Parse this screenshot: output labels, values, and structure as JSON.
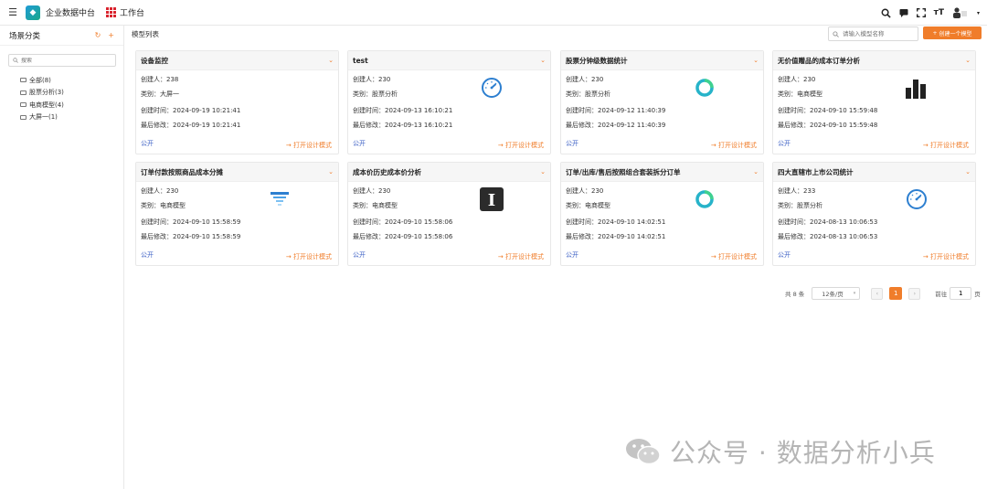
{
  "header": {
    "app_title": "企业数据中台",
    "workbench": "工作台"
  },
  "sidebar": {
    "title": "场景分类",
    "search_placeholder": "搜索",
    "items": [
      {
        "label": "全部(8)"
      },
      {
        "label": "股票分析(3)"
      },
      {
        "label": "电商模型(4)"
      },
      {
        "label": "大屏一(1)"
      }
    ]
  },
  "main": {
    "breadcrumb": "模型列表",
    "search_placeholder": "请输入模型名称",
    "create_label": "创建一个模型"
  },
  "cards": [
    {
      "title": "设备监控",
      "creator": "创建人：238",
      "category": "类别：大屏一",
      "created": "创建时间：2024-09-19 10:21:41",
      "modified": "最后修改：2024-09-19 10:21:41",
      "visibility": "公开",
      "open": "打开设计模式",
      "thumb": "none"
    },
    {
      "title": "test",
      "creator": "创建人：230",
      "category": "类别：股票分析",
      "created": "创建时间：2024-09-13 16:10:21",
      "modified": "最后修改：2024-09-13 16:10:21",
      "visibility": "公开",
      "open": "打开设计模式",
      "thumb": "gauge-icon"
    },
    {
      "title": "股票分钟级数据统计",
      "creator": "创建人：230",
      "category": "类别：股票分析",
      "created": "创建时间：2024-09-12 11:40:39",
      "modified": "最后修改：2024-09-12 11:40:39",
      "visibility": "公开",
      "open": "打开设计模式",
      "thumb": "ring-icon"
    },
    {
      "title": "无价值赠品的成本订单分析",
      "creator": "创建人：230",
      "category": "类别：电商模型",
      "created": "创建时间：2024-09-10 15:59:48",
      "modified": "最后修改：2024-09-10 15:59:48",
      "visibility": "公开",
      "open": "打开设计模式",
      "thumb": "bar-chart-icon"
    },
    {
      "title": "订单付款按照商品成本分摊",
      "creator": "创建人：230",
      "category": "类别：电商模型",
      "created": "创建时间：2024-09-10 15:58:59",
      "modified": "最后修改：2024-09-10 15:58:59",
      "visibility": "公开",
      "open": "打开设计模式",
      "thumb": "funnel-icon"
    },
    {
      "title": "成本价历史成本价分析",
      "creator": "创建人：230",
      "category": "类别：电商模型",
      "created": "创建时间：2024-09-10 15:58:06",
      "modified": "最后修改：2024-09-10 15:58:06",
      "visibility": "公开",
      "open": "打开设计模式",
      "thumb": "text-icon"
    },
    {
      "title": "订单/出库/售后按照组合套装拆分订单",
      "creator": "创建人：230",
      "category": "类别：电商模型",
      "created": "创建时间：2024-09-10 14:02:51",
      "modified": "最后修改：2024-09-10 14:02:51",
      "visibility": "公开",
      "open": "打开设计模式",
      "thumb": "ring-icon"
    },
    {
      "title": "四大直辖市上市公司统计",
      "creator": "创建人：233",
      "category": "类别：股票分析",
      "created": "创建时间：2024-08-13 10:06:53",
      "modified": "最后修改：2024-08-13 10:06:53",
      "visibility": "公开",
      "open": "打开设计模式",
      "thumb": "gauge-icon"
    }
  ],
  "pager": {
    "total": "共 8 条",
    "page_size": "12条/页",
    "current": "1",
    "goto_label": "前往",
    "goto_value": "1",
    "page_suffix": "页"
  },
  "watermark": "公众号 · 数据分析小兵",
  "colors": {
    "accent": "#f07d2a",
    "link": "#3a5ec4",
    "gauge": "#2d7fd0",
    "ring": "#27b3c9"
  }
}
